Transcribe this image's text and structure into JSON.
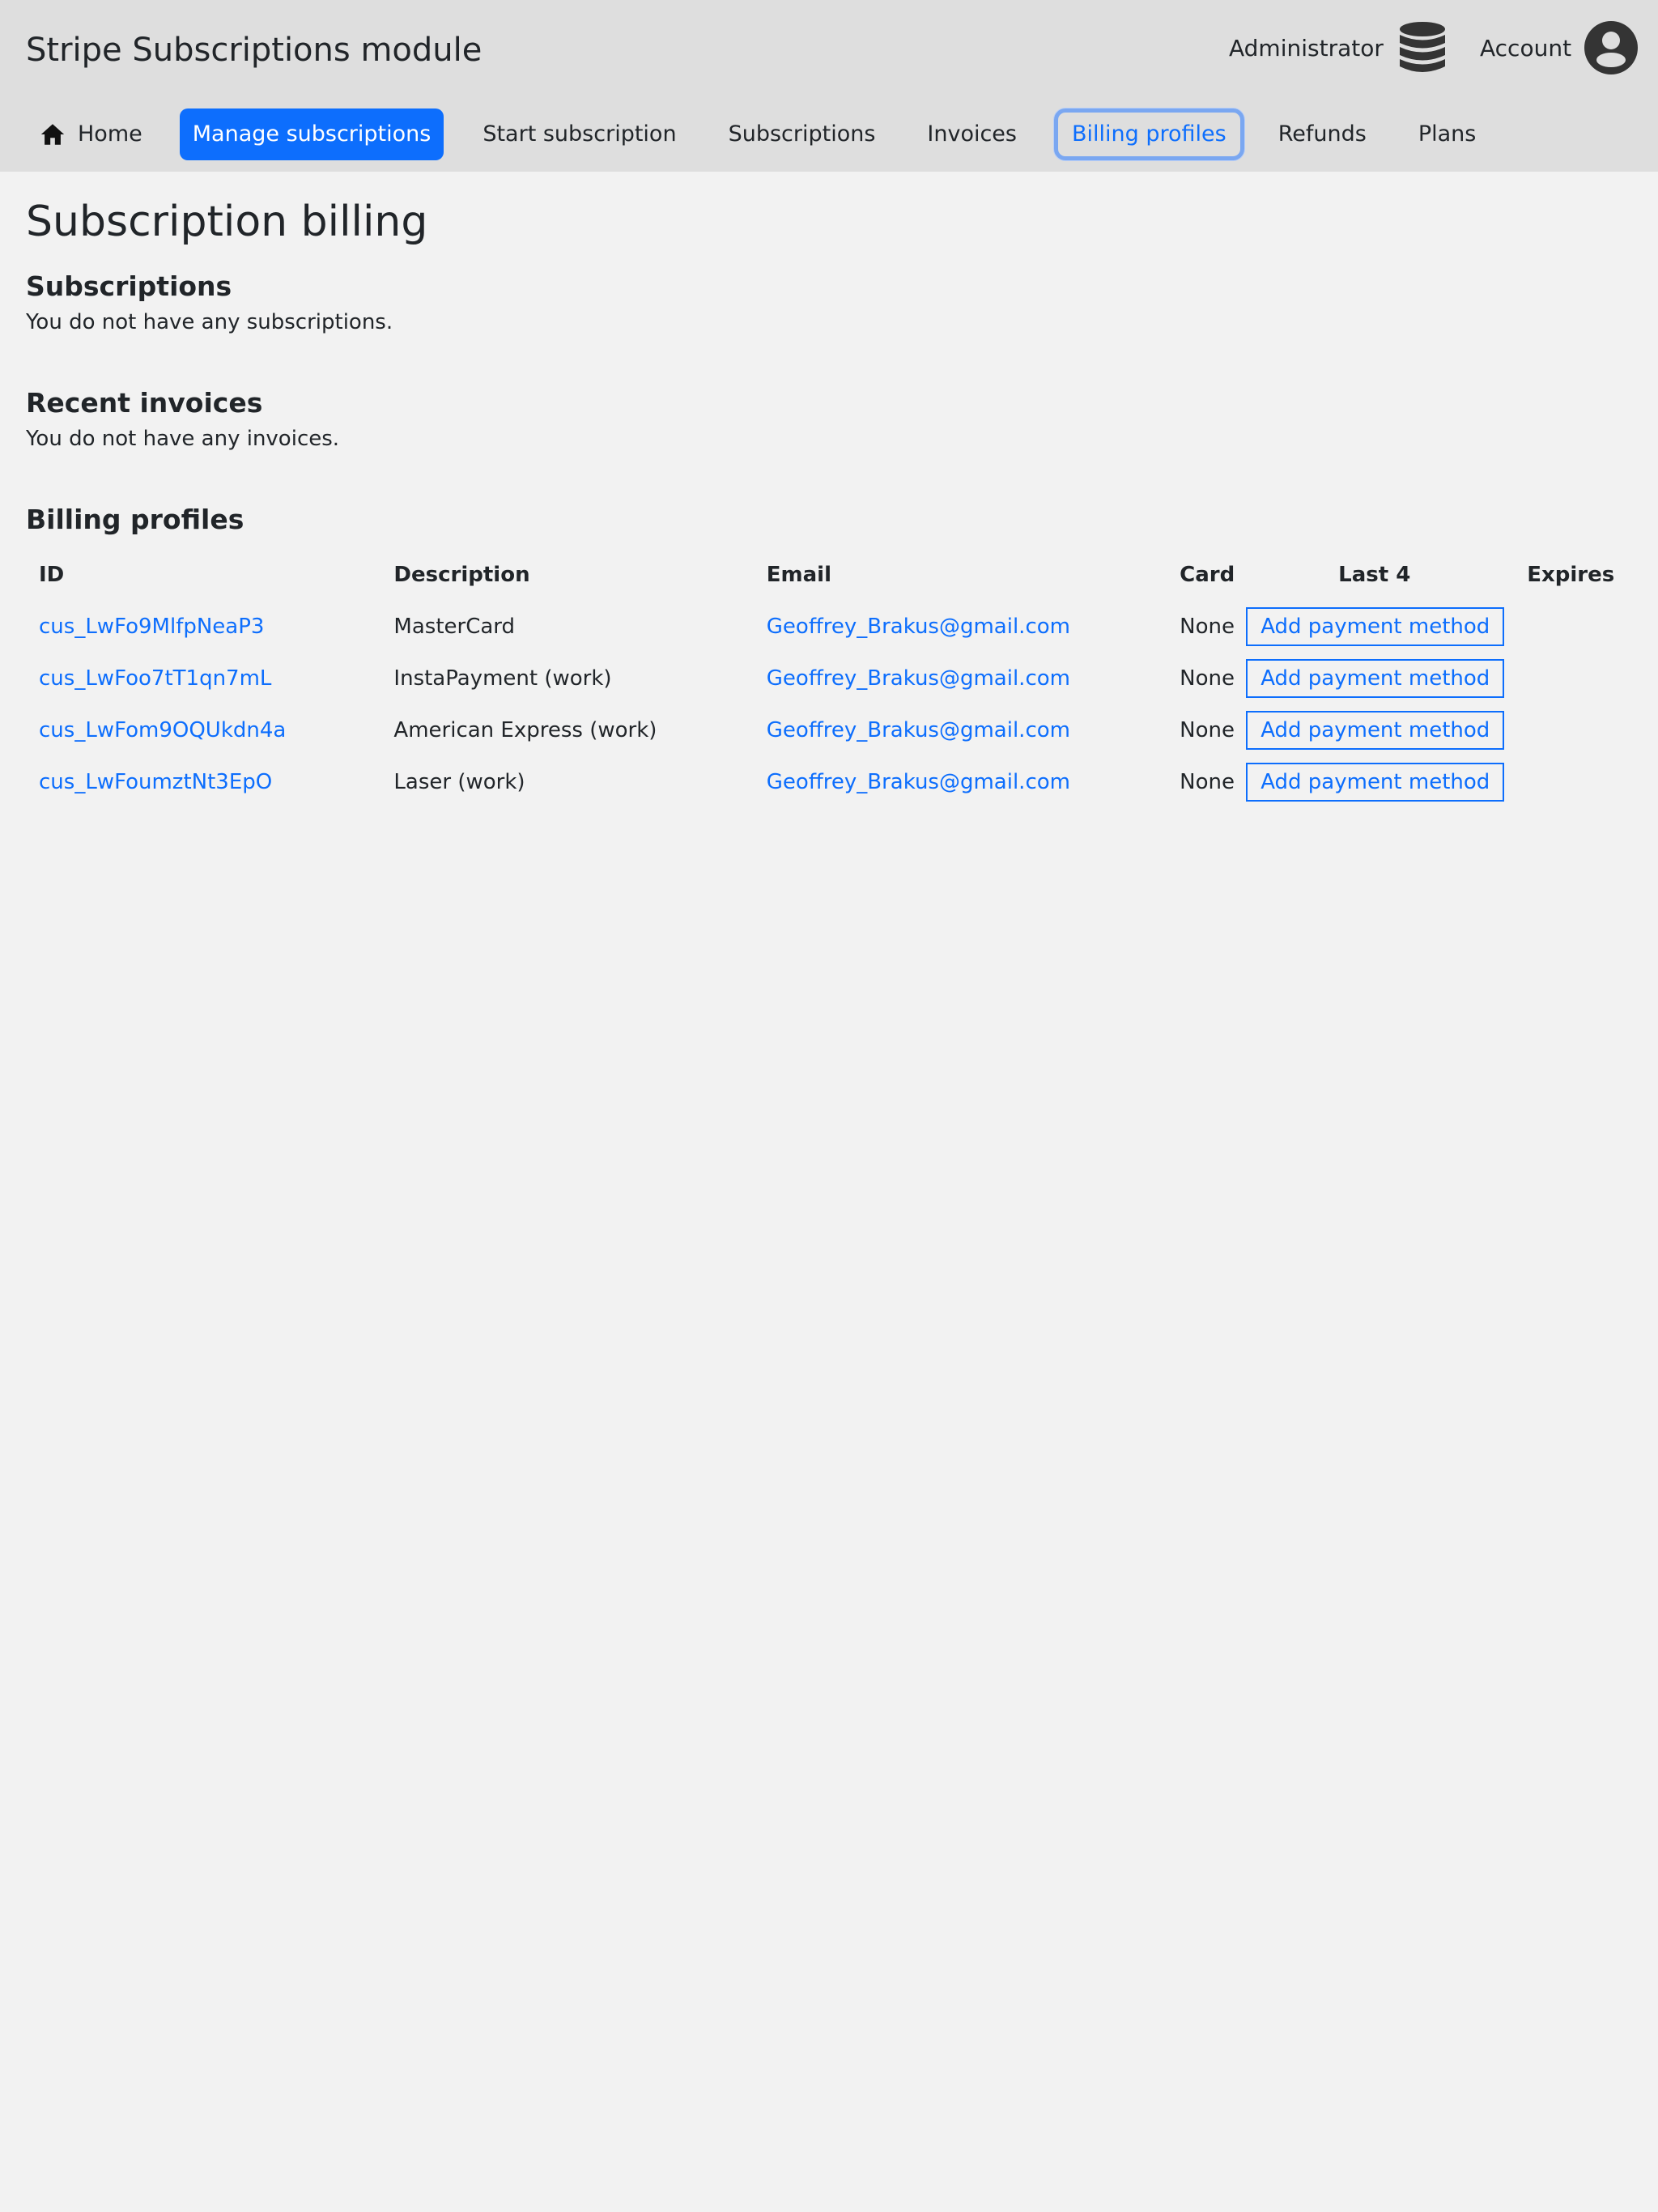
{
  "header": {
    "site_title": "Stripe Subscriptions module",
    "admin_label": "Administrator",
    "admin_icon": "database-icon",
    "account_label": "Account",
    "account_icon": "user-circle-icon"
  },
  "nav": {
    "items": [
      {
        "label": "Home",
        "icon": "home-icon"
      },
      {
        "label": "Manage subscriptions",
        "state": "active"
      },
      {
        "label": "Start subscription"
      },
      {
        "label": "Subscriptions"
      },
      {
        "label": "Invoices"
      },
      {
        "label": "Billing profiles",
        "state": "focused"
      },
      {
        "label": "Refunds"
      },
      {
        "label": "Plans"
      }
    ]
  },
  "main": {
    "page_title": "Subscription billing",
    "subscriptions": {
      "title": "Subscriptions",
      "empty_text": "You do not have any subscriptions."
    },
    "invoices": {
      "title": "Recent invoices",
      "empty_text": "You do not have any invoices."
    },
    "billing_profiles": {
      "title": "Billing profiles",
      "columns": [
        "ID",
        "Description",
        "Email",
        "Card",
        "Last 4",
        "Expires"
      ],
      "rows": [
        {
          "id": "cus_LwFo9MlfpNeaP3",
          "description": "MasterCard",
          "email": "Geoffrey_Brakus@gmail.com",
          "card": "None",
          "action": "Add payment method"
        },
        {
          "id": "cus_LwFoo7tT1qn7mL",
          "description": "InstaPayment (work)",
          "email": "Geoffrey_Brakus@gmail.com",
          "card": "None",
          "action": "Add payment method"
        },
        {
          "id": "cus_LwFom9OQUkdn4a",
          "description": "American Express (work)",
          "email": "Geoffrey_Brakus@gmail.com",
          "card": "None",
          "action": "Add payment method"
        },
        {
          "id": "cus_LwFoumztNt3EpO",
          "description": "Laser (work)",
          "email": "Geoffrey_Brakus@gmail.com",
          "card": "None",
          "action": "Add payment method"
        }
      ]
    }
  },
  "colors": {
    "header_bg": "#dedede",
    "page_bg": "#f2f2f2",
    "accent": "#0d6efd",
    "text": "#212529"
  }
}
